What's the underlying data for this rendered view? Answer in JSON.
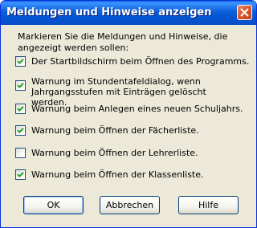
{
  "window": {
    "title": "Meldungen und Hinweise anzeigen"
  },
  "intro": "Markieren Sie die Meldungen und Hinweise, die angezeigt werden sollen:",
  "options": [
    {
      "label": "Der Startbildschirm beim Öffnen des Programms.",
      "checked": true
    },
    {
      "label": "Warnung im Stundentafeldialog, wenn Jahrgangsstufen mit Einträgen gelöscht werden.",
      "checked": true
    },
    {
      "label": "Warnung beim Anlegen eines neuen Schuljahrs.",
      "checked": true
    },
    {
      "label": "Warnung beim Öffnen der Fächerliste.",
      "checked": true
    },
    {
      "label": "Warnung beim Öffnen der Lehrerliste.",
      "checked": false
    },
    {
      "label": "Warnung beim Öffnen der Klassenliste.",
      "checked": true
    }
  ],
  "buttons": {
    "ok": "OK",
    "cancel": "Abbrechen",
    "help": "Hilfe"
  }
}
